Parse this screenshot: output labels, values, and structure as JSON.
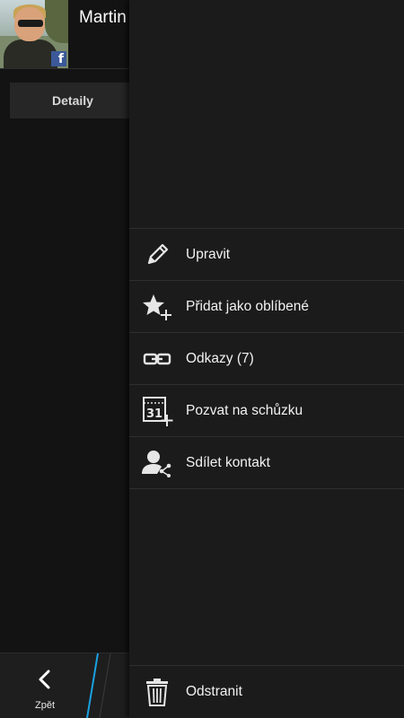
{
  "contact": {
    "name": "Martin",
    "tabs": {
      "detail": "Detaily"
    }
  },
  "bottom_bar": {
    "back_label": "Zpět"
  },
  "menu": {
    "items": [
      {
        "icon": "pencil-icon",
        "label": "Upravit"
      },
      {
        "icon": "star-add-icon",
        "label": "Přidat jako oblíbené"
      },
      {
        "icon": "link-icon",
        "label": "Odkazy (7)"
      },
      {
        "icon": "calendar-add-icon",
        "label": "Pozvat na schůzku"
      },
      {
        "icon": "share-contact-icon",
        "label": "Sdílet kontakt"
      }
    ],
    "delete": {
      "icon": "trash-icon",
      "label": "Odstranit"
    },
    "calendar_day": "31"
  },
  "colors": {
    "background": "#131313",
    "menu_background": "#1b1b1b",
    "accent": "#1aa1e1",
    "facebook": "#3b5998"
  }
}
